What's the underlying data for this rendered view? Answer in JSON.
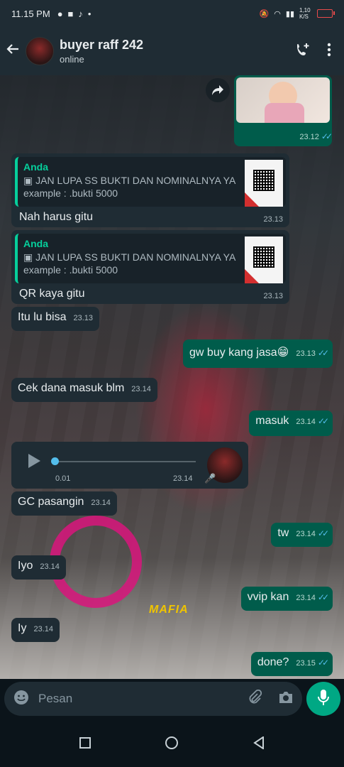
{
  "statusbar": {
    "time": "11.15 PM",
    "speed": "1,10 K/S"
  },
  "header": {
    "name": "buyer raff 242",
    "status": "online"
  },
  "composer": {
    "placeholder": "Pesan"
  },
  "messages": [
    {
      "id": "m1",
      "dir": "out",
      "type": "image",
      "time": "23.12",
      "ticks": "✓✓"
    },
    {
      "id": "m2",
      "dir": "in",
      "type": "reply",
      "quote_name": "Anda",
      "quote_text": "JAN LUPA SS BUKTI DAN NOMINALNYA YA",
      "quote_text2": "example : .bukti 5000",
      "text": "Nah harus gitu",
      "time": "23.13"
    },
    {
      "id": "m3",
      "dir": "in",
      "type": "reply",
      "quote_name": "Anda",
      "quote_text": "JAN LUPA SS BUKTI DAN NOMINALNYA YA",
      "quote_text2": "example : .bukti 5000",
      "text": "QR kaya gitu",
      "time": "23.13"
    },
    {
      "id": "m4",
      "dir": "in",
      "text": "Itu lu bisa",
      "time": "23.13"
    },
    {
      "id": "m5",
      "dir": "out",
      "text": "gw buy kang jasa",
      "emoji": "😁",
      "time": "23.13",
      "ticks": "✓✓"
    },
    {
      "id": "m6",
      "dir": "in",
      "text": "Cek dana masuk blm",
      "time": "23.14"
    },
    {
      "id": "m7",
      "dir": "out",
      "text": "masuk",
      "time": "23.14",
      "ticks": "✓✓"
    },
    {
      "id": "m8",
      "dir": "in",
      "type": "voice",
      "duration": "0.01",
      "time": "23.14"
    },
    {
      "id": "m9",
      "dir": "in",
      "text": "GC pasangin",
      "time": "23.14"
    },
    {
      "id": "m10",
      "dir": "out",
      "text": "tw",
      "time": "23.14",
      "ticks": "✓✓"
    },
    {
      "id": "m11",
      "dir": "in",
      "text": "Iyo",
      "time": "23.14"
    },
    {
      "id": "m12",
      "dir": "out",
      "text": "vvip kan",
      "time": "23.14",
      "ticks": "✓✓"
    },
    {
      "id": "m13",
      "dir": "in",
      "text": "Iy",
      "time": "23.14"
    },
    {
      "id": "m14",
      "dir": "out",
      "text": "done?",
      "time": "23.15",
      "ticks": "✓✓"
    }
  ],
  "wallpaper_logo": "MAFIA",
  "colors": {
    "incoming": "#1f2c34",
    "outgoing": "#005c4b",
    "accent": "#00a884",
    "read_ticks": "#53bdeb"
  }
}
